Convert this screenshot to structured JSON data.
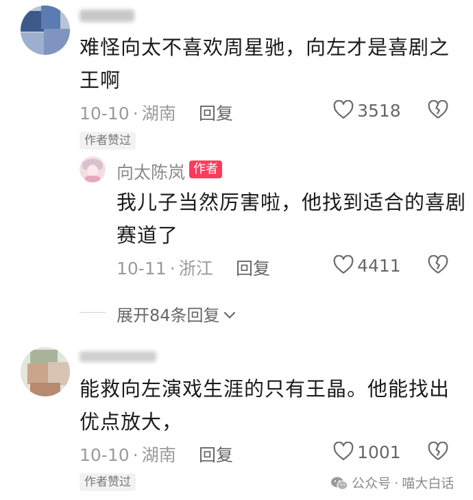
{
  "comments": [
    {
      "text_line1": "难怪向太不喜欢周星驰，向左才是喜剧之",
      "text_line2": "王啊",
      "date": "10-10",
      "location": "湖南",
      "reply_label": "回复",
      "likes": "3518",
      "author_liked_label": "作者赞过"
    },
    {
      "text_line1": "能救向左演戏生涯的只有王晶。他能找出",
      "text_line2": "优点放大，",
      "date": "10-10",
      "location": "湖南",
      "reply_label": "回复",
      "likes": "1001",
      "author_liked_label": "作者赞过"
    }
  ],
  "reply": {
    "author_name": "向太陈岚",
    "author_tag": "作者",
    "text_line1": "我儿子当然厉害啦，他找到适合的喜剧",
    "text_line2": "赛道了",
    "date": "10-11",
    "location": "浙江",
    "reply_label": "回复",
    "likes": "4411"
  },
  "expand_replies_label": "展开84条回复",
  "separator_dot": "·",
  "watermark": {
    "channel": "公众号",
    "name": "喵大白话"
  },
  "icons": {
    "like": "heart-outline-icon",
    "dislike": "broken-heart-icon",
    "expand": "chevron-down-icon",
    "wechat": "wechat-logo-icon"
  }
}
